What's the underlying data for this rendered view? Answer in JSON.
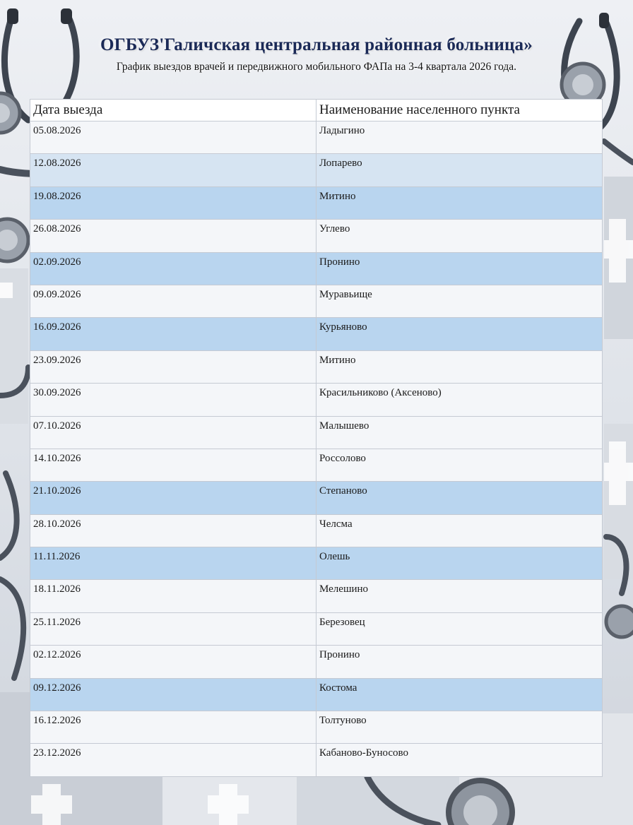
{
  "header": {
    "title": "ОГБУЗ'Галичская центральная районная больница»",
    "subtitle": "График выездов врачей и передвижного мобильного ФАПа на 3-4 квартала 2026 года."
  },
  "table": {
    "columns": [
      "Дата выезда",
      "Наименование населенного пункта"
    ],
    "rows": [
      {
        "date": "05.08.2026",
        "place": "Ладыгино",
        "shade": "white"
      },
      {
        "date": "12.08.2026",
        "place": "Лопарево",
        "shade": "light"
      },
      {
        "date": "19.08.2026",
        "place": "Митино",
        "shade": "blue"
      },
      {
        "date": "26.08.2026",
        "place": "Углево",
        "shade": "white"
      },
      {
        "date": "02.09.2026",
        "place": "Пронино",
        "shade": "blue"
      },
      {
        "date": "09.09.2026",
        "place": "Муравьище",
        "shade": "white"
      },
      {
        "date": "16.09.2026",
        "place": "Курьяново",
        "shade": "blue"
      },
      {
        "date": "23.09.2026",
        "place": "Митино",
        "shade": "white"
      },
      {
        "date": "30.09.2026",
        "place": "Красильниково (Аксеново)",
        "shade": "white"
      },
      {
        "date": "07.10.2026",
        "place": "Малышево",
        "shade": "white"
      },
      {
        "date": "14.10.2026",
        "place": "Россолово",
        "shade": "white"
      },
      {
        "date": "21.10.2026",
        "place": "Степаново",
        "shade": "blue"
      },
      {
        "date": "28.10.2026",
        "place": "Челсма",
        "shade": "white"
      },
      {
        "date": "11.11.2026",
        "place": "Олешь",
        "shade": "blue"
      },
      {
        "date": "18.11.2026",
        "place": "Мелешино",
        "shade": "white"
      },
      {
        "date": "25.11.2026",
        "place": "Березовец",
        "shade": "white"
      },
      {
        "date": "02.12.2026",
        "place": "Пронино",
        "shade": "white"
      },
      {
        "date": "09.12.2026",
        "place": "Костома",
        "shade": "blue"
      },
      {
        "date": "16.12.2026",
        "place": "Толтуново",
        "shade": "white"
      },
      {
        "date": "23.12.2026",
        "place": "Кабаново-Буносово",
        "shade": "white"
      }
    ]
  },
  "colors": {
    "title": "#1b2a57",
    "row_white": "#f4f6f9",
    "row_light": "#d6e4f2",
    "row_blue": "#b9d5ef"
  }
}
